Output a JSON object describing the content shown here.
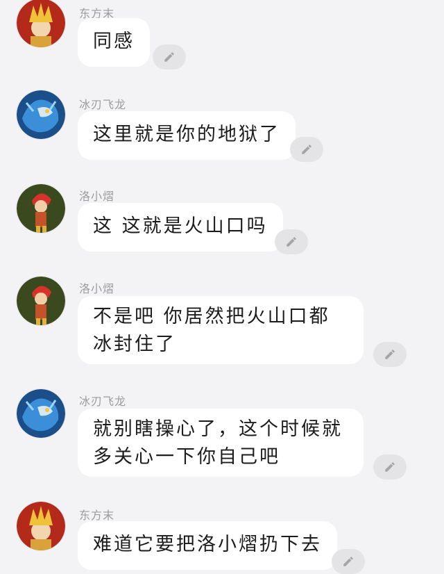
{
  "messages": [
    {
      "sender": "东方末",
      "text": "同感",
      "avatar_icon": "blonde-boy-avatar",
      "bg": "#c8872a"
    },
    {
      "sender": "冰刃飞龙",
      "text": "这里就是你的地狱了",
      "avatar_icon": "blue-dragon-avatar",
      "bg": "#1c5fa0"
    },
    {
      "sender": "洛小熠",
      "text": "这 这就是火山口吗",
      "avatar_icon": "red-hair-boy-avatar",
      "bg": "#3b4a1e"
    },
    {
      "sender": "洛小熠",
      "text": "不是吧 你居然把火山口都冰封住了",
      "avatar_icon": "red-hair-boy-avatar",
      "bg": "#3b4a1e"
    },
    {
      "sender": "冰刃飞龙",
      "text": "就别瞎操心了，这个时候就多关心一下你自己吧",
      "avatar_icon": "blue-dragon-avatar",
      "bg": "#1c5fa0"
    },
    {
      "sender": "东方末",
      "text": "难道它要把洛小熠扔下去",
      "avatar_icon": "blonde-boy-avatar",
      "bg": "#c8872a"
    }
  ],
  "edit_icon": "pencil-icon"
}
